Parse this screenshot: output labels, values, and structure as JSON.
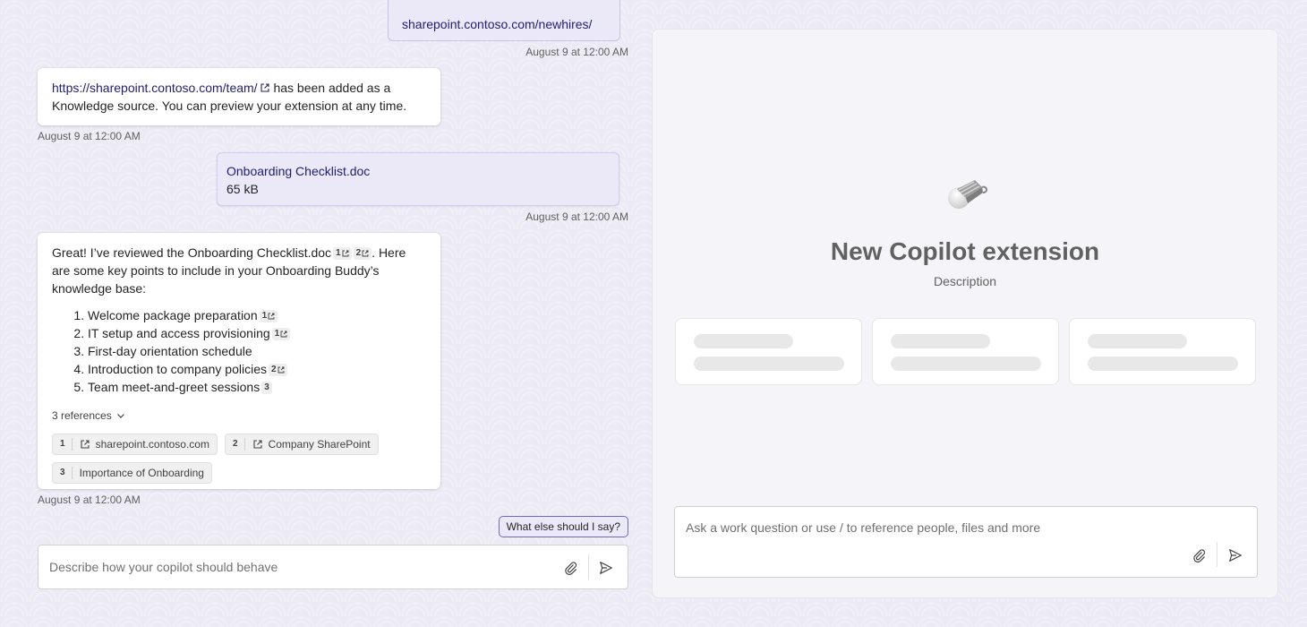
{
  "left_chat": {
    "top_cutoff_text": "sharepoint.contoso.com/newhires/",
    "messages": [
      {
        "timestamp": "August 9 at 12:00 AM"
      },
      {
        "link": "https://sharepoint.contoso.com/team/",
        "text": " has been added as a Knowledge source. You can preview your extension at any time.",
        "timestamp": "August 9 at 12:00 AM"
      },
      {
        "file_name": "Onboarding Checklist.doc",
        "file_size": "65 kB",
        "timestamp": "August 9 at 12:00 AM"
      },
      {
        "intro_a": "Great! I’ve reviewed the Onboarding Checklist.doc",
        "intro_b": ". Here are some key points to include in your Onboarding Buddy’s knowledge base:",
        "cite1": "1",
        "cite2": "2",
        "items": [
          {
            "text": "Welcome package preparation",
            "cite": "1"
          },
          {
            "text": "IT setup and access provisioning",
            "cite": "1"
          },
          {
            "text": "First-day orientation schedule",
            "cite": ""
          },
          {
            "text": "Introduction to company policies",
            "cite": "2"
          },
          {
            "text": "Team meet-and-greet sessions",
            "cite": "3"
          }
        ],
        "references_label": "3 references",
        "references": [
          {
            "num": "1",
            "label": "sharepoint.contoso.com"
          },
          {
            "num": "2",
            "label": "Company SharePoint"
          },
          {
            "num": "3",
            "label": "Importance of Onboarding"
          }
        ],
        "timestamp": "August 9 at 12:00 AM"
      }
    ],
    "suggestion": "What else should I say?",
    "composer_placeholder": "Describe how your copilot should behave"
  },
  "preview": {
    "title": "New Copilot extension",
    "description": "Description",
    "composer_placeholder": "Ask a work question or use / to reference people, files and more"
  }
}
